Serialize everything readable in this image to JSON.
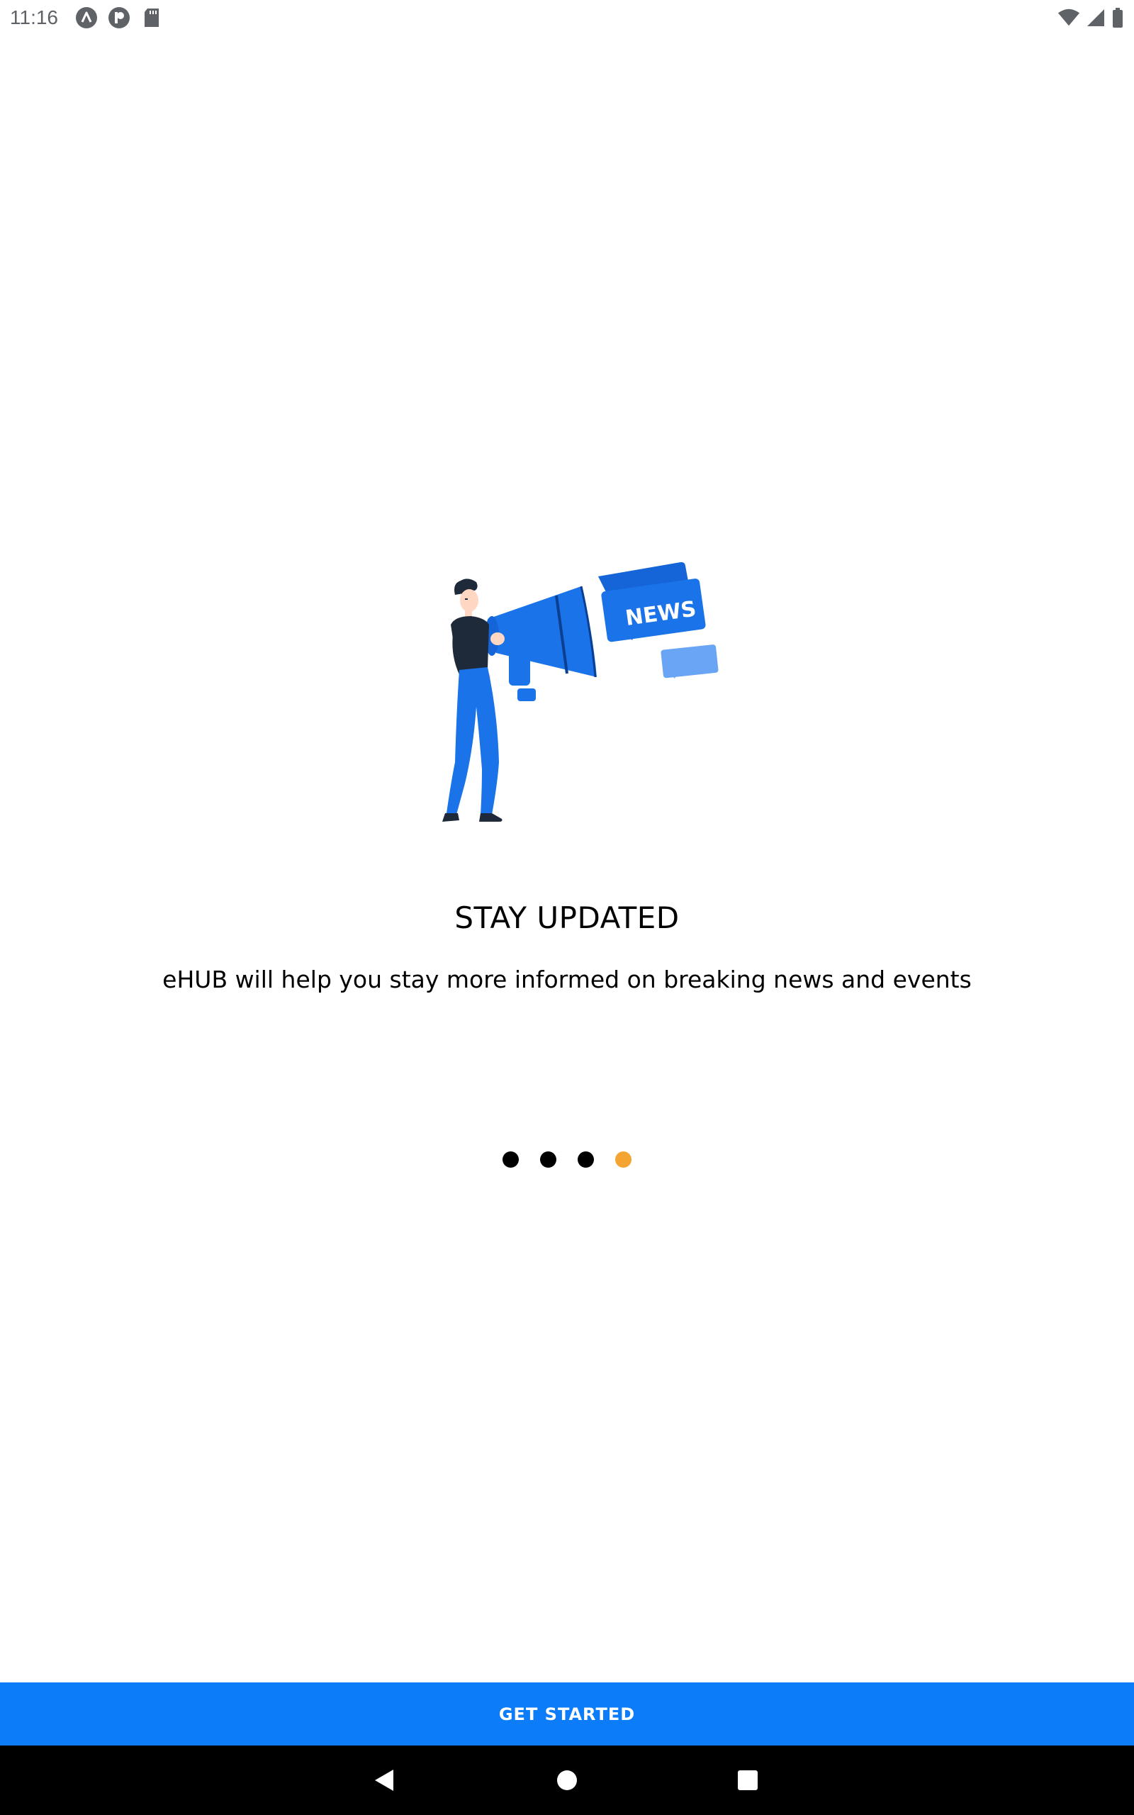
{
  "status_bar": {
    "time": "11:16",
    "notification_icons": [
      "app-a-icon",
      "app-p-icon",
      "sd-card-icon"
    ],
    "system_icons": [
      "wifi-icon",
      "cellular-signal-icon",
      "battery-icon"
    ]
  },
  "onboarding": {
    "illustration": "man-with-megaphone-news-illustration",
    "illustration_text": "NEWS",
    "title": "STAY UPDATED",
    "description": "eHUB will help you stay more informed on breaking news and events",
    "page_count": 4,
    "active_page": 4
  },
  "get_started_label": "GET STARTED",
  "nav_bar": {
    "buttons": [
      "back-icon",
      "home-icon",
      "recents-icon"
    ]
  },
  "colors": {
    "accent": "#0d7cf8",
    "active_dot": "#f4a433",
    "inactive_dot": "#000000",
    "illustration_blue": "#1a73e8"
  }
}
